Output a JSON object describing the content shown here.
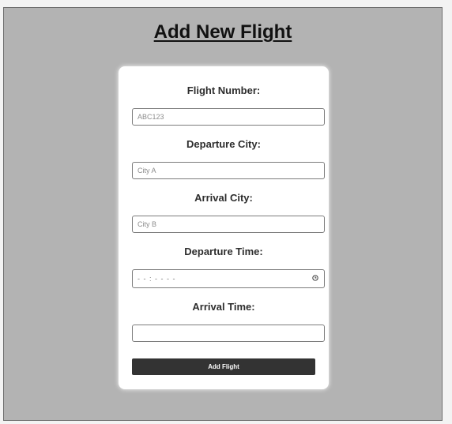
{
  "page": {
    "title": "Add New Flight"
  },
  "form": {
    "flight_number": {
      "label": "Flight Number:",
      "placeholder": "ABC123",
      "value": ""
    },
    "departure_city": {
      "label": "Departure City:",
      "placeholder": "City A",
      "value": ""
    },
    "arrival_city": {
      "label": "Arrival City:",
      "placeholder": "City B",
      "value": ""
    },
    "departure_time": {
      "label": "Departure Time:",
      "display": "- - : - -   - -",
      "icon": "clock-icon"
    },
    "arrival_time": {
      "label": "Arrival Time:",
      "value": ""
    },
    "submit_label": "Add Flight"
  },
  "colors": {
    "background": "#b3b3b3",
    "card": "#ffffff",
    "button": "#333333",
    "button_text": "#ffffff",
    "title_text": "#111111"
  }
}
